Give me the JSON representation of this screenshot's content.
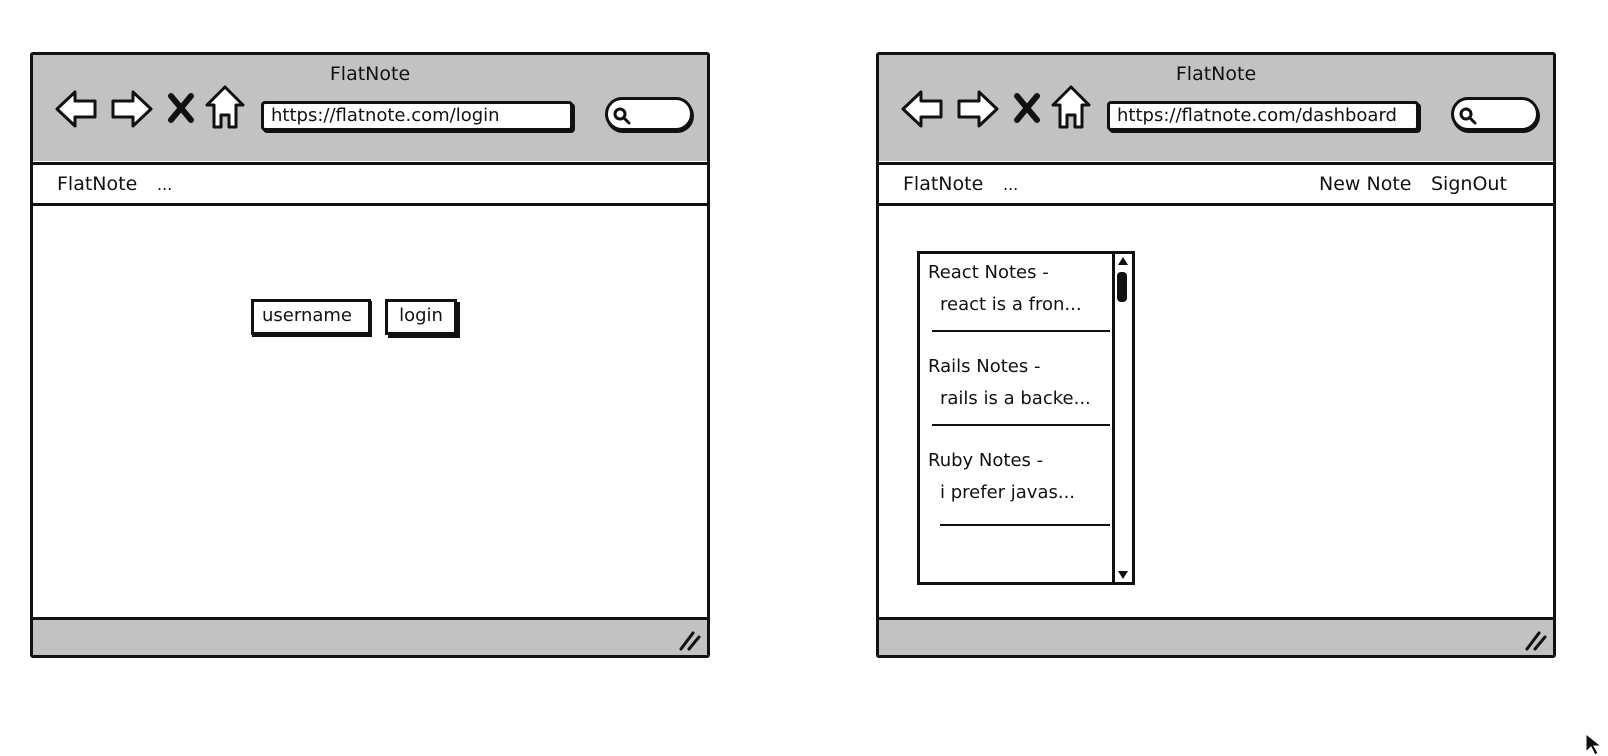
{
  "left_window": {
    "title": "FlatNote",
    "url": "https://flatnote.com/login",
    "menu": {
      "brand": "FlatNote",
      "more": "..."
    },
    "form": {
      "username_placeholder": "username",
      "login_label": "login"
    }
  },
  "right_window": {
    "title": "FlatNote",
    "url": "https://flatnote.com/dashboard",
    "menu": {
      "brand": "FlatNote",
      "more": "...",
      "new_note": "New Note",
      "sign_out": "SignOut"
    },
    "notes": [
      {
        "title": "React Notes -",
        "preview": "react is a fron..."
      },
      {
        "title": "Rails Notes -",
        "preview": "rails is a backe..."
      },
      {
        "title": "Ruby Notes -",
        "preview": "i prefer javas..."
      }
    ]
  },
  "icons": {
    "back": "back-arrow-icon",
    "forward": "forward-arrow-icon",
    "stop": "stop-x-icon",
    "home": "home-icon",
    "search": "search-icon",
    "resize": "resize-grip-icon",
    "cursor": "mouse-pointer-icon"
  },
  "colors": {
    "chrome": "#c2c2c2",
    "stroke": "#111111",
    "background": "#ffffff"
  }
}
